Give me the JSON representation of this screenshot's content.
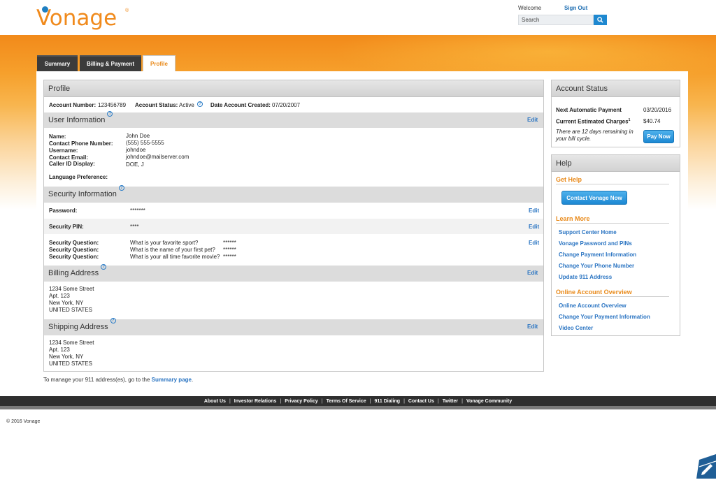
{
  "brand": {
    "logo_text": "Vonage",
    "logo_mark": "®",
    "accent": "#f08a1c",
    "link": "#2a74c2"
  },
  "header": {
    "welcome": "Welcome",
    "sign_out": "Sign Out",
    "search_placeholder": "Search"
  },
  "tabs": [
    {
      "label": "Summary",
      "active": false
    },
    {
      "label": "Billing & Payment",
      "active": false
    },
    {
      "label": "Profile",
      "active": true
    }
  ],
  "profile": {
    "title": "Profile",
    "account_number_label": "Account Number:",
    "account_number": "123456789",
    "account_status_label": "Account Status:",
    "account_status": "Active",
    "date_created_label": "Date Account Created:",
    "date_created": "07/20/2007",
    "user_info": {
      "title": "User Information",
      "edit": "Edit",
      "fields": [
        {
          "label": "Name:",
          "value": "John Doe"
        },
        {
          "label": "Contact Phone Number:",
          "value": "(555) 555-5555"
        },
        {
          "label": "Username:",
          "value": "johndoe"
        },
        {
          "label": "Contact Email:",
          "value": "johndoe@mailserver.com"
        },
        {
          "label": "Caller ID Display:",
          "value": "DOE, J"
        }
      ],
      "language_label": "Language Preference:",
      "language_value": ""
    },
    "security": {
      "title": "Security Information",
      "password_label": "Password:",
      "password_value": "*******",
      "pin_label": "Security PIN:",
      "pin_value": "****",
      "edit": "Edit",
      "questions": [
        {
          "label": "Security Question:",
          "question": "What is your favorite sport?",
          "answer": "******"
        },
        {
          "label": "Security Question:",
          "question": "What is the name of your first pet?",
          "answer": "******"
        },
        {
          "label": "Security Question:",
          "question": "What is your all time favorite movie?",
          "answer": "******"
        }
      ]
    },
    "billing_address": {
      "title": "Billing Address",
      "edit": "Edit",
      "lines": [
        "1234 Some Street",
        "Apt. 123",
        "New York, NY",
        "UNITED STATES"
      ]
    },
    "shipping_address": {
      "title": "Shipping Address",
      "edit": "Edit",
      "lines": [
        "1234 Some Street",
        "Apt. 123",
        "New York, NY",
        "UNITED STATES"
      ]
    },
    "manage_note": "To manage your 911 address(es), go to the",
    "manage_link": "Summary page",
    "manage_end": "."
  },
  "account_status": {
    "title": "Account Status",
    "next_payment_label": "Next Automatic Payment",
    "next_payment_date": "03/20/2016",
    "charges_label": "Current Estimated Charges",
    "charges_sup": "1",
    "charges_value": "$40.74",
    "cycle_note": "There are 12 days remaining in your bill cycle.",
    "pay_now": "Pay Now"
  },
  "help": {
    "title": "Help",
    "get_help": "Get Help",
    "contact_button": "Contact Vonage Now",
    "learn_more": "Learn More",
    "learn_links": [
      "Support Center Home",
      "Vonage Password and PINs",
      "Change Payment Information",
      "Change Your Phone Number",
      "Update 911 Address"
    ],
    "online_overview": "Online Account Overview",
    "overview_links": [
      "Online Account Overview",
      "Change Your Payment Information",
      "Video Center"
    ]
  },
  "footer": {
    "links": [
      "About Us",
      "Investor Relations",
      "Privacy Policy",
      "Terms Of Service",
      "911 Dialing",
      "Contact Us",
      "Twitter",
      "Vonage Community"
    ],
    "copyright": "© 2016 Vonage"
  }
}
